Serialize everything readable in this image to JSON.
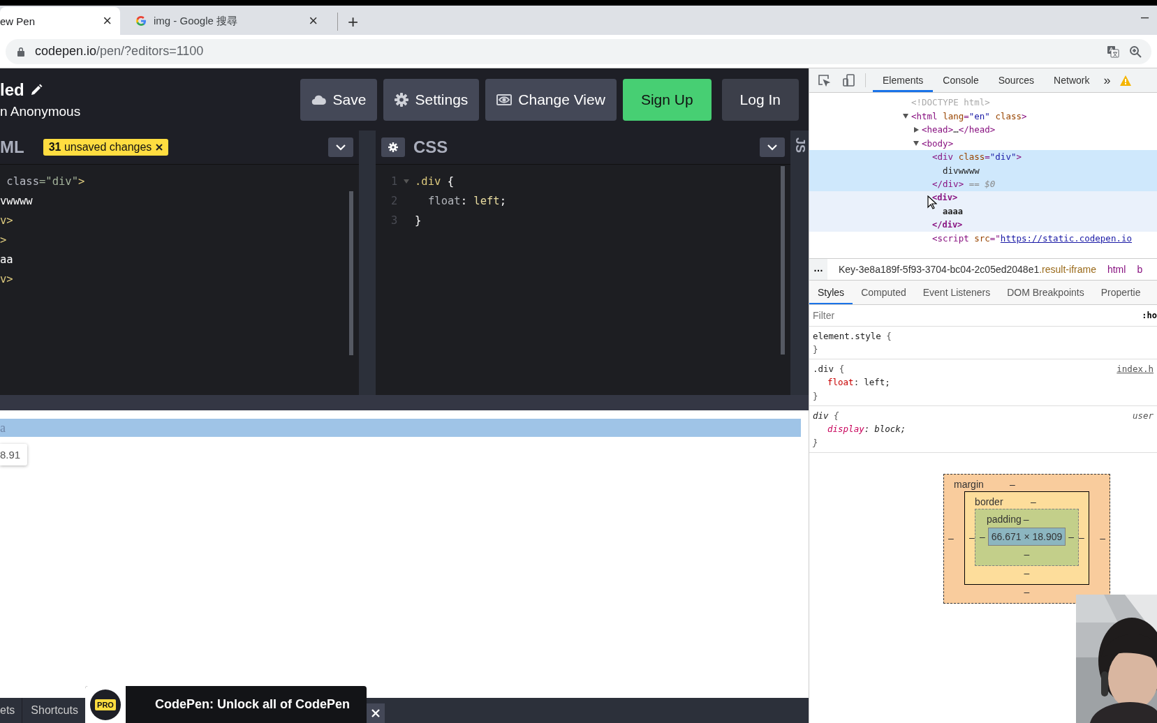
{
  "browser": {
    "tabs": [
      {
        "title": "ew Pen",
        "close": "×",
        "selected": true,
        "has_favicon": false
      },
      {
        "title": "img - Google 搜尋",
        "close": "×",
        "selected": false,
        "has_favicon": true
      }
    ],
    "new_tab": "+",
    "minimize": "–",
    "url": {
      "host": "codepen.io",
      "path": "/pen/?editors=1100"
    }
  },
  "codepen": {
    "title": "led",
    "author": "n Anonymous",
    "buttons": [
      {
        "label": "Save",
        "kind": "default"
      },
      {
        "label": "Settings",
        "kind": "default"
      },
      {
        "label": "Change View",
        "kind": "default"
      },
      {
        "label": "Sign Up",
        "kind": "primary"
      },
      {
        "label": "Log In",
        "kind": "plain"
      }
    ],
    "editors": [
      {
        "title": "ML",
        "badge": "**31** unsaved changes",
        "lines": [
          [
            {
              "kind": "attr",
              "text": " class"
            },
            {
              "kind": "string",
              "text": "=\"div\""
            },
            {
              "kind": "tag",
              "text": ">"
            }
          ],
          [
            {
              "kind": "text",
              "text": "vwwww"
            }
          ],
          [
            {
              "kind": "tag",
              "text": "v>"
            }
          ],
          [
            {
              "kind": "tag",
              "text": ">"
            }
          ],
          [
            {
              "kind": "text",
              "text": "aa"
            }
          ],
          [
            {
              "kind": "tag",
              "text": "v>"
            }
          ]
        ]
      },
      {
        "title": "CSS",
        "settings": true,
        "lines": [
          [
            {
              "kind": "number",
              "text": "1"
            },
            {
              "kind": "selector",
              "text": ".div"
            },
            {
              "kind": "text",
              "text": " {"
            }
          ],
          [
            {
              "kind": "number",
              "text": "2"
            },
            {
              "kind": "property",
              "text": "float"
            },
            {
              "kind": "text",
              "text": ": "
            },
            {
              "kind": "value",
              "text": "left"
            },
            {
              "kind": "text",
              "text": ";"
            }
          ],
          [
            {
              "kind": "number",
              "text": "3"
            },
            {
              "kind": "text",
              "text": "}"
            }
          ]
        ]
      }
    ],
    "js_tab": "JS",
    "result": {
      "highlight_text": "a",
      "tooltip": "8.91"
    },
    "footer": {
      "buttons": [
        "ets",
        "Shortcuts"
      ],
      "promo": {
        "badge": "PRO",
        "text": "CodePen: Unlock all of CodePen"
      }
    }
  },
  "devtools": {
    "tabs": [
      {
        "label": "Elements",
        "selected": true
      },
      {
        "label": "Console",
        "selected": false
      },
      {
        "label": "Sources",
        "selected": false
      },
      {
        "label": "Network",
        "selected": false
      }
    ],
    "more": "»",
    "tree": [
      {
        "tokens": [
          {
            "kind": "doctype",
            "text": "<!DOCTYPE html>"
          }
        ]
      },
      {
        "tokens": [
          {
            "kind": "tag",
            "text": "<html "
          },
          {
            "kind": "attr",
            "text": "lang"
          },
          {
            "kind": "tag",
            "text": "="
          },
          {
            "kind": "value",
            "text": "\"en\""
          },
          {
            "kind": "attr",
            "text": " class"
          },
          {
            "kind": "tag",
            "text": ">"
          }
        ],
        "expanded": true,
        "children": [
          {
            "tokens": [
              {
                "kind": "tag",
                "text": "<head>"
              },
              {
                "kind": "text",
                "text": "…"
              },
              {
                "kind": "tag",
                "text": "</head>"
              }
            ],
            "expanded": false
          },
          {
            "tokens": [
              {
                "kind": "tag",
                "text": "<body>"
              }
            ],
            "expanded": true,
            "children": [
              {
                "tokens": [
                  {
                    "kind": "tag",
                    "text": "<div "
                  },
                  {
                    "kind": "attr",
                    "text": "class"
                  },
                  {
                    "kind": "tag",
                    "text": "="
                  },
                  {
                    "kind": "value",
                    "text": "\"div\""
                  },
                  {
                    "kind": "tag",
                    "text": ">"
                  }
                ],
                "selected": true,
                "hovered": false,
                "children": [
                  {
                    "tokens": [
                      {
                        "kind": "text",
                        "text": "divwwww"
                      }
                    ]
                  }
                ],
                "close": [
                  {
                    "kind": "tag",
                    "text": "</div>"
                  },
                  {
                    "kind": "marker",
                    "text": " == $0"
                  }
                ]
              },
              {
                "tokens": [
                  {
                    "kind": "tag",
                    "text": "<div>"
                  }
                ],
                "selected": false,
                "hovered": true,
                "children": [
                  {
                    "tokens": [
                      {
                        "kind": "text",
                        "text": "aaaa"
                      }
                    ]
                  }
                ],
                "close": [
                  {
                    "kind": "tag",
                    "text": "</div>"
                  }
                ]
              },
              {
                "tokens": [
                  {
                    "kind": "tag",
                    "text": "<script "
                  },
                  {
                    "kind": "attr",
                    "text": "src"
                  },
                  {
                    "kind": "tag",
                    "text": "=\""
                  },
                  {
                    "kind": "link",
                    "text": "https://static.codepen.io"
                  }
                ]
              }
            ]
          }
        ]
      }
    ],
    "breadcrumb_more": "…",
    "breadcrumb": [
      [
        {
          "kind": "text",
          "text": "Key-3e8a189f-5f93-3704-bc04-2c05ed2048e1"
        },
        {
          "kind": "class",
          "text": ".result-iframe"
        }
      ],
      [
        {
          "kind": "tag",
          "text": "html"
        }
      ],
      [
        {
          "kind": "tag",
          "text": "b"
        }
      ]
    ],
    "panel_tabs": [
      {
        "label": "Styles",
        "selected": true
      },
      {
        "label": "Computed",
        "selected": false
      },
      {
        "label": "Event Listeners",
        "selected": false
      },
      {
        "label": "DOM Breakpoints",
        "selected": false
      },
      {
        "label": "Propertie",
        "selected": false
      }
    ],
    "filter": {
      "placeholder": "Filter"
    },
    "filter_toggle": ":ho",
    "rules": [
      {
        "selector": "element.style",
        "open": " {",
        "close": "}",
        "user_agent": false
      },
      {
        "selector": ".div",
        "open": " {",
        "close": "}",
        "source": "index.h",
        "user_agent": false,
        "declarations": [
          {
            "property": "float",
            "separator": ":",
            "value": "left;"
          }
        ]
      },
      {
        "selector": "div",
        "open": " {",
        "close": "}",
        "source": "user",
        "user_agent": true,
        "declarations": [
          {
            "property": "display",
            "separator": ":",
            "value": "block;"
          }
        ]
      }
    ],
    "box_model": {
      "margin": {
        "label": "margin",
        "top": "–",
        "right": "–",
        "bottom": "–",
        "left": "–"
      },
      "border": {
        "label": "border",
        "top": "–",
        "right": "–",
        "bottom": "–",
        "left": "–"
      },
      "padding": {
        "label": "padding",
        "top": "–",
        "right": "–",
        "bottom": "–",
        "left": "–"
      },
      "content": "66.671 × 18.909"
    },
    "webcam": {
      "kind": "picture"
    }
  }
}
